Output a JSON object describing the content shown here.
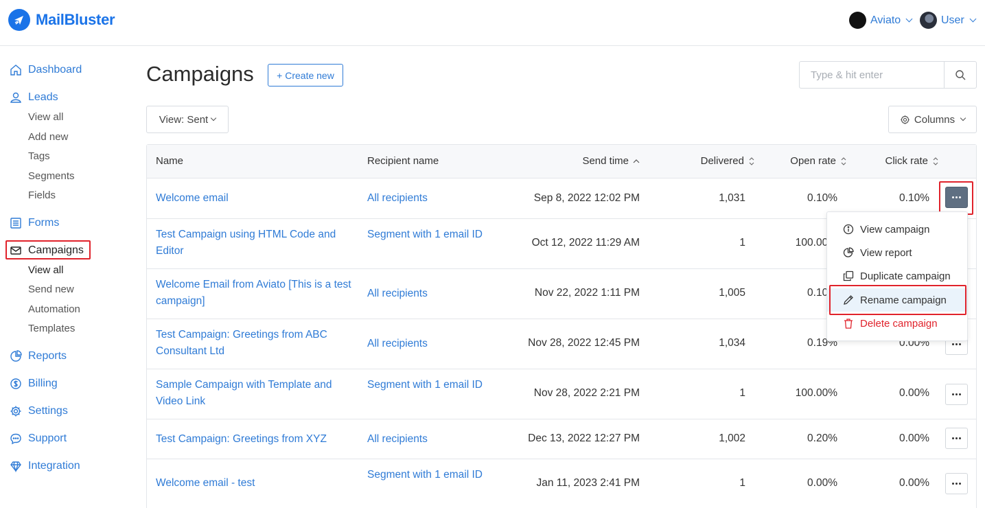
{
  "brand": {
    "name": "MailBluster"
  },
  "header": {
    "workspace": "Aviato",
    "user": "User"
  },
  "sidebar": {
    "items": [
      {
        "label": "Dashboard"
      },
      {
        "label": "Leads",
        "sub": [
          "View all",
          "Add new",
          "Tags",
          "Segments",
          "Fields"
        ]
      },
      {
        "label": "Forms"
      },
      {
        "label": "Campaigns",
        "sub": [
          "View all",
          "Send new",
          "Automation",
          "Templates"
        ]
      },
      {
        "label": "Reports"
      },
      {
        "label": "Billing"
      },
      {
        "label": "Settings"
      },
      {
        "label": "Support"
      },
      {
        "label": "Integration"
      }
    ]
  },
  "main": {
    "title": "Campaigns",
    "create_label": "+ Create new",
    "search_placeholder": "Type & hit enter",
    "view_label": "View: Sent",
    "columns_label": "Columns"
  },
  "table": {
    "headers": [
      "Name",
      "Recipient name",
      "Send time",
      "Delivered",
      "Open rate",
      "Click rate"
    ],
    "rows": [
      {
        "name": "Welcome email",
        "recipient": "All recipients",
        "time": "Sep 8, 2022 12:02 PM",
        "delivered": "1,031",
        "open": "0.10%",
        "click": "0.10%"
      },
      {
        "name": "Test Campaign using HTML Code and Editor",
        "recipient": "Segment with 1 email ID",
        "time": "Oct 12, 2022 11:29 AM",
        "delivered": "1",
        "open": "100.00%",
        "click": ""
      },
      {
        "name": "Welcome Email from Aviato [This is a test campaign]",
        "recipient": "All recipients",
        "time": "Nov 22, 2022 1:11 PM",
        "delivered": "1,005",
        "open": "0.10%",
        "click": ""
      },
      {
        "name": "Test Campaign: Greetings from ABC Consultant Ltd",
        "recipient": "All recipients",
        "time": "Nov 28, 2022 12:45 PM",
        "delivered": "1,034",
        "open": "0.19%",
        "click": "0.00%"
      },
      {
        "name": "Sample Campaign with Template and Video Link",
        "recipient": "Segment with 1 email ID",
        "time": "Nov 28, 2022 2:21 PM",
        "delivered": "1",
        "open": "100.00%",
        "click": "0.00%"
      },
      {
        "name": "Test Campaign: Greetings from XYZ",
        "recipient": "All recipients",
        "time": "Dec 13, 2022 12:27 PM",
        "delivered": "1,002",
        "open": "0.20%",
        "click": "0.00%"
      },
      {
        "name": "Welcome email - test",
        "recipient": "Segment with 1 email ID",
        "time": "Jan 11, 2023 2:41 PM",
        "delivered": "1",
        "open": "0.00%",
        "click": "0.00%"
      }
    ]
  },
  "menu": {
    "items": [
      "View campaign",
      "View report",
      "Duplicate campaign",
      "Rename campaign",
      "Delete campaign"
    ]
  },
  "colors": {
    "accent": "#2f7bd6",
    "danger": "#e0222b",
    "highlight": "#eaf3fb"
  }
}
